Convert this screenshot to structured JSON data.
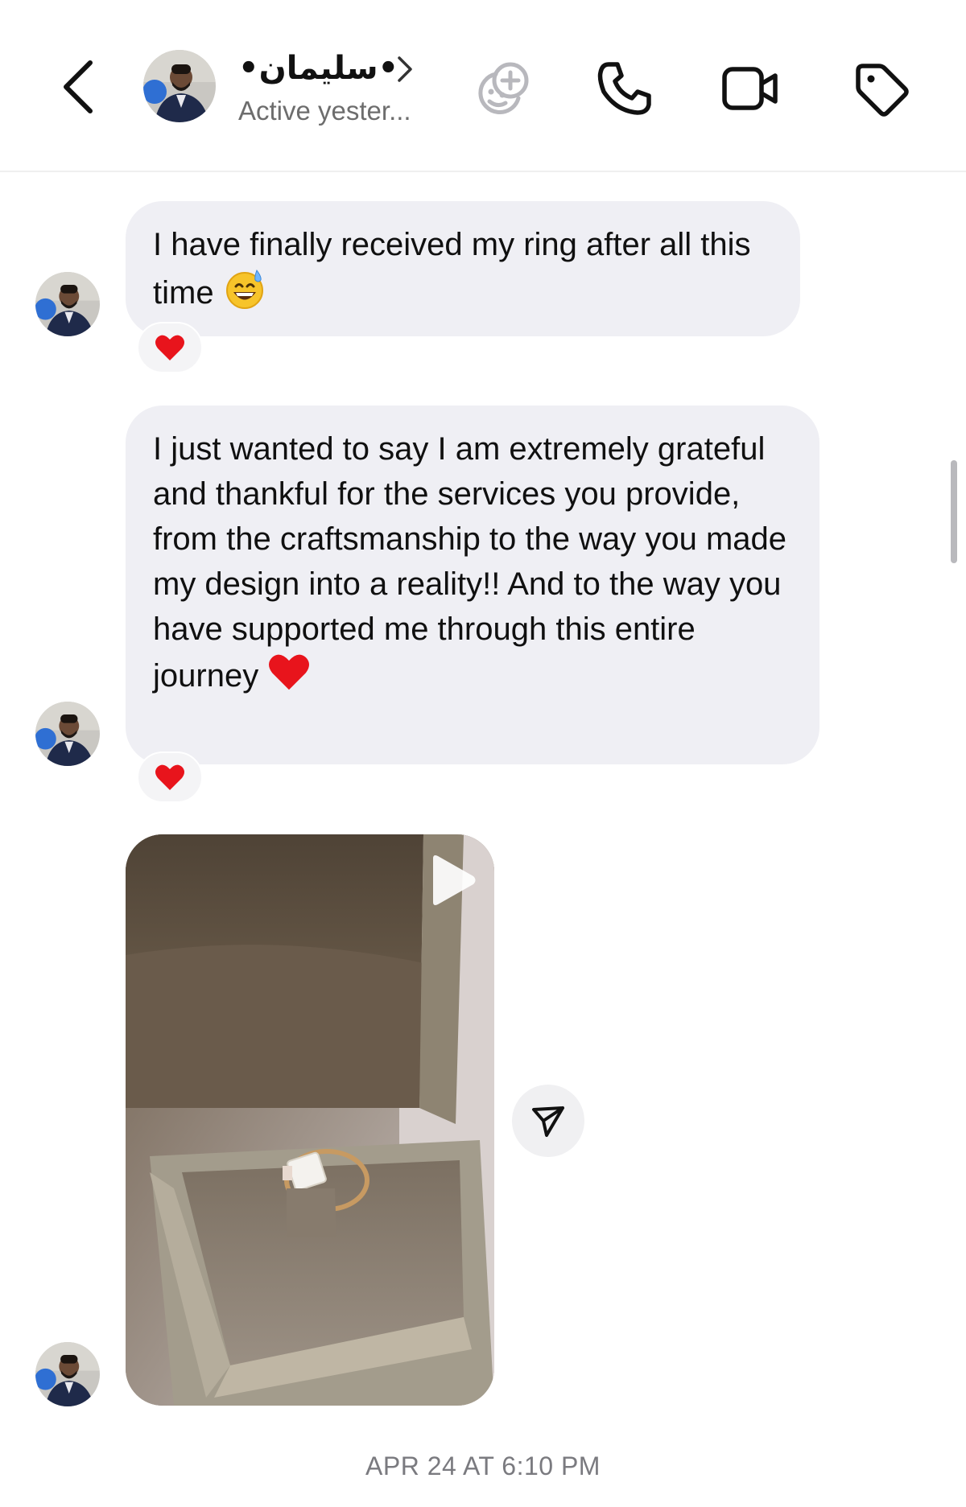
{
  "header": {
    "contact_name": "•سليمان•",
    "presence": "Active yester...",
    "icons": [
      "back-chevron-icon",
      "chevron-right-icon",
      "sticker-add-icon",
      "phone-icon",
      "video-camera-icon",
      "tag-icon"
    ]
  },
  "messages": [
    {
      "type": "text",
      "text": "I have finally received my ring after all this time",
      "emoji": "😅",
      "reaction": "❤️"
    },
    {
      "type": "text",
      "text": "I just wanted to say I am extremely grateful and thankful for the services you provide, from the craftsmanship to the way you made my design into a reality!! And to the way you have supported me through this entire journey",
      "emoji": "❤️",
      "reaction": "❤️"
    },
    {
      "type": "video",
      "icons": [
        "play-icon",
        "share-icon"
      ]
    }
  ],
  "timestamp": "APR 24 AT 6:10 PM",
  "colors": {
    "bubble": "#efeff4",
    "secondary_text": "#6d6d6d",
    "heart": "#e8141c"
  }
}
